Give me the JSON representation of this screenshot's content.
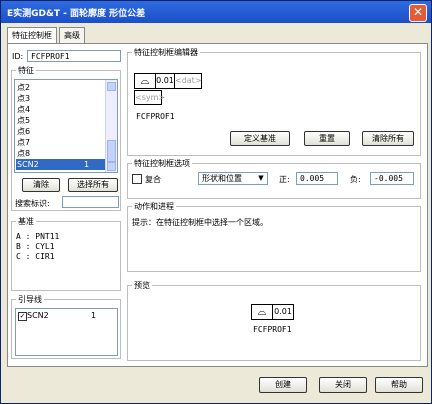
{
  "window": {
    "title": "E实测GD&T - 面轮廓度 形位公差",
    "close_glyph": "✕"
  },
  "tabs": [
    "特征控制框",
    "高级"
  ],
  "id_field": {
    "label": "ID:",
    "value": "FCFPROF1"
  },
  "features": {
    "title": "特征",
    "items": [
      {
        "name": "点2",
        "value": ""
      },
      {
        "name": "点3",
        "value": ""
      },
      {
        "name": "点4",
        "value": ""
      },
      {
        "name": "点5",
        "value": ""
      },
      {
        "name": "点6",
        "value": ""
      },
      {
        "name": "点7",
        "value": ""
      },
      {
        "name": "点8",
        "value": ""
      },
      {
        "name": "SCN2",
        "value": "1"
      }
    ],
    "selected_index": 7,
    "clear_label": "清除",
    "select_all_label": "选择所有",
    "search_label": "搜索标识:",
    "search_value": ""
  },
  "datums": {
    "title": "基准",
    "lines": [
      "A : PNT11",
      "B : CYL1",
      "C : CIR1"
    ]
  },
  "leader": {
    "title": "引导线",
    "items": [
      {
        "name": "SCN2",
        "value": "1",
        "checked": true
      }
    ]
  },
  "editor": {
    "title": "特征控制框编辑器",
    "symbol": "⌓",
    "tolerance": "0.01",
    "dat_placeholder": "<dat>",
    "sym_placeholder": "<sym>",
    "fcf_name": "FCFPROF1",
    "define_datum": "定义基准",
    "reset": "重置",
    "clear_all": "清除所有"
  },
  "options": {
    "title": "特征控制框选项",
    "composite_label": "复合",
    "composite_checked": false,
    "mode": "形状和位置",
    "plus_label": "正:",
    "plus_value": "0.005",
    "minus_label": "负:",
    "minus_value": "-0.005"
  },
  "action": {
    "title": "动作和进程",
    "hint": "提示：在特征控制框中选择一个区域。"
  },
  "preview": {
    "title": "预览",
    "symbol": "⌓",
    "tolerance": "0.01",
    "name": "FCFPROF1"
  },
  "footer": {
    "create": "创建",
    "close": "关闭",
    "help": "帮助"
  }
}
